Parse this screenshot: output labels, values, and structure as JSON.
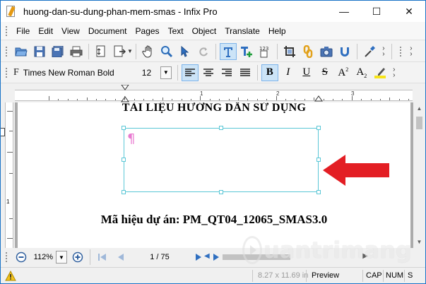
{
  "window": {
    "title": "huong-dan-su-dung-phan-mem-smas - Infix Pro",
    "controls": {
      "minimize": "—",
      "maximize": "☐",
      "close": "✕"
    }
  },
  "menu": {
    "items": [
      "File",
      "Edit",
      "View",
      "Document",
      "Pages",
      "Text",
      "Object",
      "Translate",
      "Help"
    ]
  },
  "toolbar_format": {
    "font_name": "Times New Roman Bold",
    "font_size": "12",
    "bold": "B",
    "italic": "I",
    "underline": "U",
    "strike": "S",
    "superscript_main": "A",
    "superscript_mark": "2",
    "subscript_main": "A",
    "subscript_mark": "2"
  },
  "ruler": {
    "labels": [
      "1",
      "2",
      "3"
    ]
  },
  "document": {
    "title": "TÀI LIỆU HƯỚNG DẪN SỬ DỤNG",
    "paragraph_mark": "¶",
    "code_line": "Mã hiệu dự án:  PM_QT04_12065_SMAS3.0"
  },
  "navigation": {
    "zoom": "112%",
    "page_indicator": "1 / 75"
  },
  "status": {
    "page_size": "8.27 x 11.69 in",
    "mode": "Preview",
    "caps": "CAP",
    "num": "NUM",
    "scroll": "S"
  },
  "watermark": {
    "text": "uantrimang"
  },
  "colors": {
    "accent_red": "#e31e24",
    "selection_box": "#5bc7d6",
    "active_button": "#cce4f7"
  }
}
